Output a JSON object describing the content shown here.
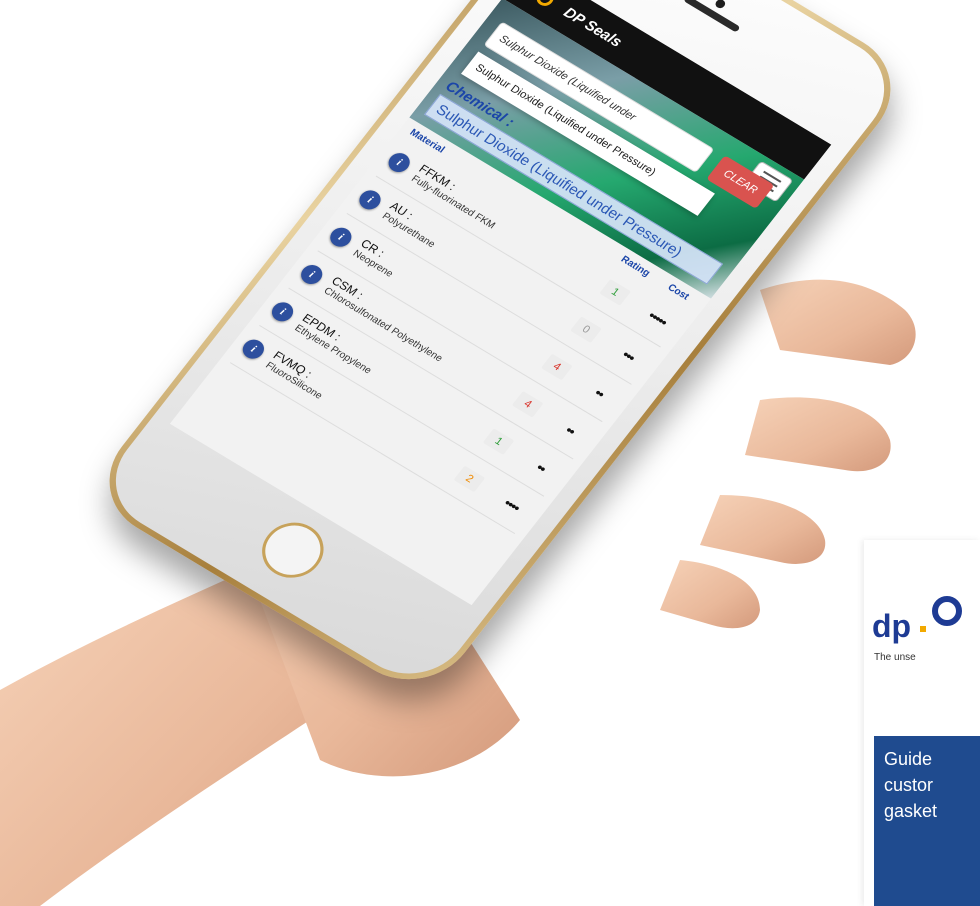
{
  "app": {
    "title": "DP Seals"
  },
  "search": {
    "value": "Sulphur Dioxide (Liquified under",
    "suggestion": "Sulphur Dioxide (Liquified under Pressure)",
    "clear_label": "CLEAR"
  },
  "chemical": {
    "label": "Chemical :",
    "name": "Sulphur Dioxide (Liquified under Pressure)"
  },
  "table": {
    "headers": {
      "material": "Material",
      "rating": "Rating",
      "cost": "Cost"
    },
    "rows": [
      {
        "code": "FFKM :",
        "desc": "Fully-fluorinated FKM",
        "rating": "1",
        "rating_color": "#2f9e3a",
        "cost": "•••••"
      },
      {
        "code": "AU :",
        "desc": "Polyurethane",
        "rating": "0",
        "rating_color": "#9a9a9a",
        "cost": "•••"
      },
      {
        "code": "CR :",
        "desc": "Neoprene",
        "rating": "4",
        "rating_color": "#d9342b",
        "cost": "••"
      },
      {
        "code": "CSM :",
        "desc": "Chlorosulfonated Polyethylene",
        "rating": "4",
        "rating_color": "#d9342b",
        "cost": "••"
      },
      {
        "code": "EPDM :",
        "desc": "Ethylene Propylene",
        "rating": "1",
        "rating_color": "#2f9e3a",
        "cost": "••"
      },
      {
        "code": "FVMQ :",
        "desc": "FluoroSilicone",
        "rating": "2",
        "rating_color": "#f08a00",
        "cost": "••••"
      }
    ]
  },
  "brand": {
    "word": "dp",
    "tagline": "The unse",
    "panel_lines": [
      "Guide",
      "custor",
      "gasket"
    ]
  },
  "colors": {
    "navbar": "#111111",
    "accent": "#2d4f9e",
    "clear": "#d9534f"
  }
}
